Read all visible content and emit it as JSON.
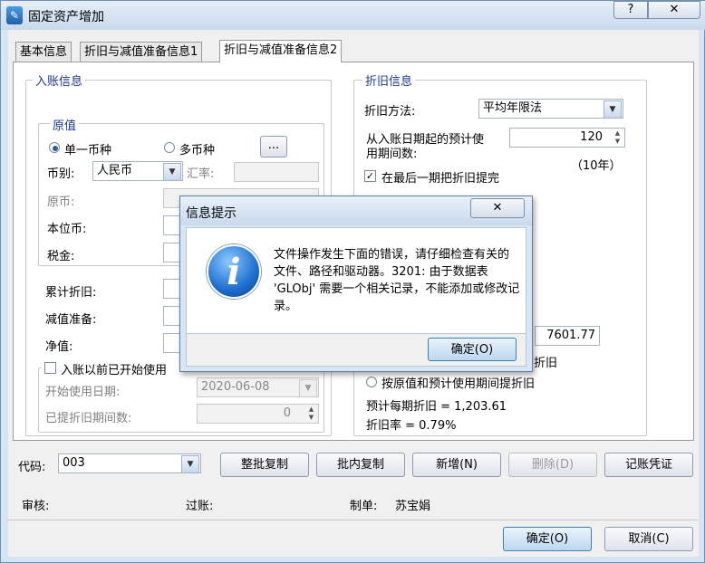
{
  "window": {
    "title": "固定资产增加",
    "help_glyph": "?",
    "close_glyph": "✕",
    "app_glyph": "✎"
  },
  "tabs": [
    "基本信息",
    "折旧与减值准备信息1",
    "折旧与减值准备信息2"
  ],
  "entry": {
    "legend": "入账信息",
    "original": {
      "legend": "原值",
      "single_currency": "单一币种",
      "multi_currency": "多币种",
      "ellipsis": "...",
      "currency_label": "币别:",
      "currency_value": "人民币",
      "rate_label": "汇率:",
      "original_currency_label": "原币:",
      "local_currency_label": "本位币:",
      "tax_label": "税金:"
    },
    "accum_depr_label": "累计折旧:",
    "impairment_label": "减值准备:",
    "net_value_label": "净值:",
    "started_before_label": "入账以前已开始使用",
    "start_date_label": "开始使用日期:",
    "start_date_value": "2020-06-08",
    "periods_depr_label": "已提折旧期间数:",
    "periods_depr_value": "0"
  },
  "depreciation": {
    "legend": "折旧信息",
    "method_label": "折旧方法:",
    "method_value": "平均年限法",
    "life_label_line1": "从入账日期起的预计使",
    "life_label_line2": "用期间数:",
    "life_value": "120",
    "years_note": "（10年）",
    "last_period_label": "在最后一期把折旧提完",
    "partial_value": "7601.77",
    "partial_radio_tail": "折旧",
    "by_original_label": "按原值和预计使用期间提折旧",
    "per_period_text": "预计每期折旧 = 1,203.61",
    "rate_text": "折旧率 = 0.79%"
  },
  "bottom": {
    "code_label": "代码:",
    "code_value": "003",
    "buttons": [
      "整批复制",
      "批内复制",
      "新增(N)",
      "删除(D)",
      "记账凭证"
    ],
    "audit_label": "审核:",
    "post_label": "过账:",
    "maker_label": "制单:",
    "maker_value": "苏宝娟",
    "ok_label": "确定(O)",
    "cancel_label": "取消(C)"
  },
  "dialog": {
    "title": "信息提示",
    "close_glyph": "✕",
    "icon_glyph": "i",
    "message": "文件操作发生下面的错误，请仔细检查有关的文件、路径和驱动器。3201: 由于数据表 'GLObj' 需要一个相关记录，不能添加或修改记录。",
    "ok_label": "确定(O)"
  }
}
